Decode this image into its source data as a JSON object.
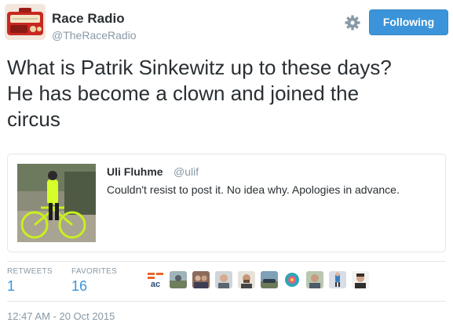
{
  "author": {
    "name": "Race Radio",
    "handle": "@TheRaceRadio"
  },
  "follow_button": {
    "label": "Following"
  },
  "tweet": {
    "text_line1": "What is Patrik Sinkewitz up to these days?",
    "text_line2": "He has become a clown and joined the",
    "text_line3": "circus"
  },
  "quoted": {
    "name": "Uli Fluhme",
    "handle": "@ulif",
    "text": "Couldn't resist to post it. No idea why. Apologies in advance."
  },
  "stats": {
    "retweets_label": "RETWEETS",
    "retweets_value": "1",
    "favorites_label": "FAVORITES",
    "favorites_value": "16"
  },
  "favoriter_avatars": [
    "orange-logo-avatar",
    "landscape-avatar",
    "group-photo-avatar",
    "portrait-avatar",
    "bearded-man-avatar",
    "car-avatar",
    "colorful-badge-avatar",
    "man-outdoors-avatar",
    "cyclist-avatar",
    "dark-hair-man-avatar"
  ],
  "timestamp": "12:47 AM - 20 Oct 2015",
  "colors": {
    "accent": "#3b94d9",
    "muted": "#8899a6",
    "text": "#292f33"
  }
}
